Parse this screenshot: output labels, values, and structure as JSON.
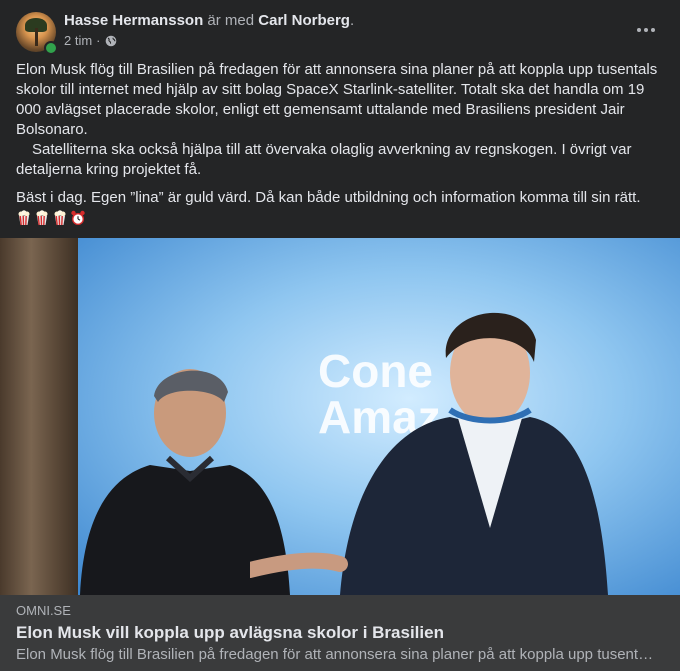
{
  "post": {
    "author": "Hasse Hermansson",
    "with_text": "är med",
    "tagged": "Carl Norberg",
    "tagged_suffix": ".",
    "time": "2 tim",
    "separator": "·",
    "audience_icon": "globe-icon",
    "more_icon": "more-horizontal-icon",
    "paragraph1": "Elon Musk flög till Brasilien på fredagen för att annonsera sina planer på att koppla upp tusentals skolor till internet med hjälp av sitt bolag SpaceX Starlink-satelliter. Totalt ska det handla om 19 000 avlägset placerade skolor, enligt ett gemensamt uttalande med Brasiliens president Jair Bolsonaro.",
    "paragraph2": "Satelliterna ska också hjälpa till att övervaka olaglig avverkning av regnskogen. I övrigt var detaljerna kring projektet få.",
    "paragraph3": "Bäst i dag. Egen ”lina” är guld värd. Då kan både utbildning och information komma till sin rätt.",
    "emojis": [
      "popcorn-icon",
      "popcorn-icon",
      "popcorn-icon",
      "alarm-clock-icon"
    ]
  },
  "photo": {
    "slogan": "Cone\nAmaz"
  },
  "link_preview": {
    "domain": "OMNI.SE",
    "title": "Elon Musk vill koppla upp avlägsna skolor i Brasilien",
    "description": "Elon Musk flög till Brasilien på fredagen för att annonsera sina planer på att koppla upp tusentals skolor till internet med hjälp av sitt bolag SpaceX Starlink-satelliter."
  },
  "colors": {
    "background": "#242526",
    "link_background": "#3a3b3c",
    "primary_text": "#e4e6eb",
    "secondary_text": "#b0b3b8",
    "online": "#31a24c"
  }
}
